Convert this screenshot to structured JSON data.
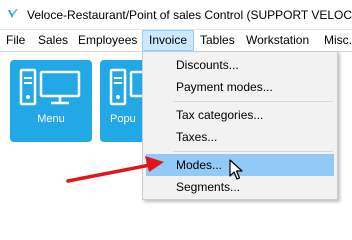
{
  "window": {
    "title": "Veloce-Restaurant/Point of sales Control (SUPPORT VELOCE)",
    "app_icon": "veloce-logo-icon"
  },
  "menubar": {
    "items": [
      {
        "label": "File"
      },
      {
        "label": "Sales"
      },
      {
        "label": "Employees"
      },
      {
        "label": "Invoice",
        "active": true
      },
      {
        "label": "Tables"
      },
      {
        "label": "Workstation"
      },
      {
        "label": "Misc."
      }
    ]
  },
  "tiles": [
    {
      "label": "Menu",
      "icon": "computer-terminal-icon"
    },
    {
      "label": "Popu",
      "icon": "computer-terminal-icon"
    }
  ],
  "invoice_menu": {
    "items": [
      {
        "label": "Discounts..."
      },
      {
        "label": "Payment modes..."
      },
      {
        "label": "Tax categories..."
      },
      {
        "label": "Taxes..."
      },
      {
        "label": "Modes...",
        "highlighted": true
      },
      {
        "label": "Segments..."
      }
    ]
  },
  "colors": {
    "tile": "#22a8e6",
    "menu_highlight": "#91c9f7",
    "annotation_arrow": "#e0161b"
  }
}
